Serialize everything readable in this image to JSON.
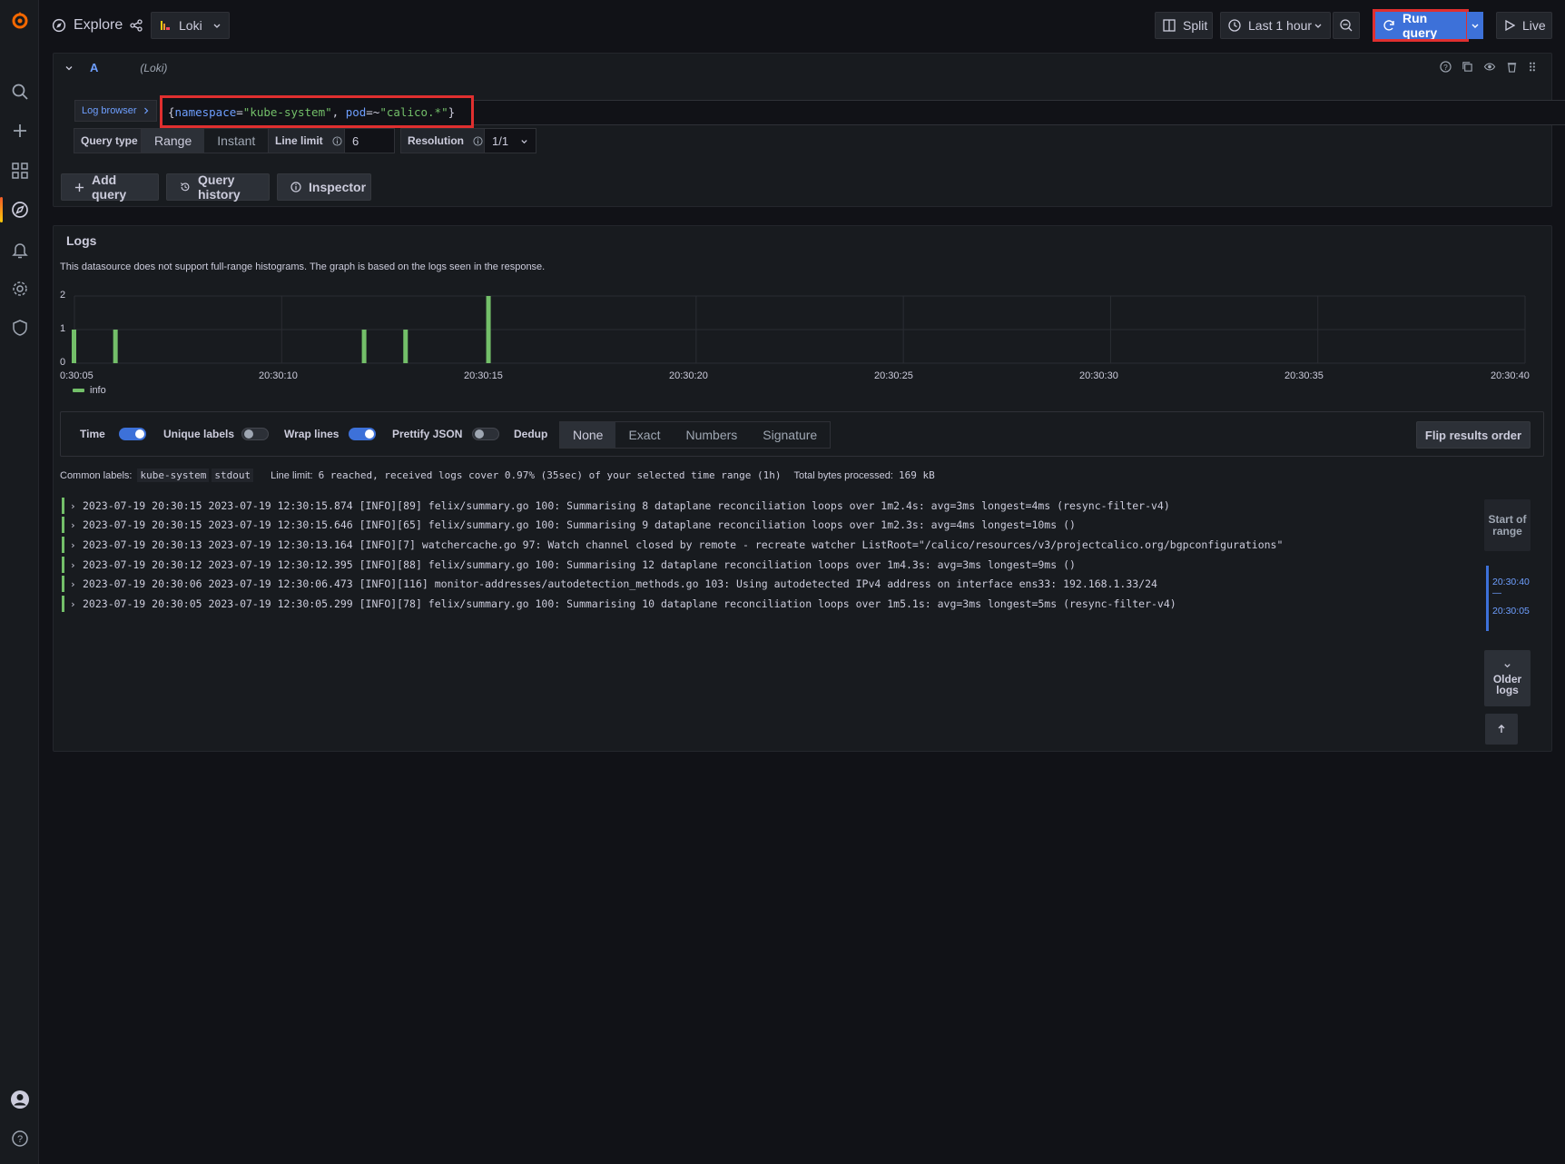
{
  "sidebar": {
    "items": [
      "search-icon",
      "plus-icon",
      "dashboards-icon",
      "explore-icon",
      "alerting-icon",
      "configuration-icon",
      "server-admin-icon",
      "profile-icon",
      "help-icon"
    ]
  },
  "topbar": {
    "title": "Explore",
    "datasource": "Loki",
    "split_label": "Split",
    "time_range": "Last 1 hour",
    "run_query_label": "Run query",
    "live_label": "Live"
  },
  "query": {
    "ref_id": "A",
    "datasource_hint": "(Loki)",
    "log_browser_label": "Log browser",
    "expr_parts": [
      "{",
      "namespace",
      "=",
      "\"kube-system\"",
      ", ",
      "pod",
      "=~",
      "\"calico.*\"",
      "}"
    ],
    "query_type_label": "Query type",
    "query_types": [
      "Range",
      "Instant"
    ],
    "selected_query_type": "Range",
    "line_limit_label": "Line limit",
    "line_limit_value": "6",
    "resolution_label": "Resolution",
    "resolution_value": "1/1",
    "add_query_label": "Add query",
    "query_history_label": "Query history",
    "inspector_label": "Inspector"
  },
  "logs": {
    "title": "Logs",
    "notice": "This datasource does not support full-range histograms. The graph is based on the logs seen in the response.",
    "legend": "info",
    "legend_color": "#73bf69",
    "options": {
      "time": "Time",
      "unique_labels": "Unique labels",
      "wrap_lines": "Wrap lines",
      "prettify_json": "Prettify JSON",
      "dedup": "Dedup",
      "time_on": true,
      "unique_labels_on": false,
      "wrap_lines_on": true,
      "prettify_json_on": false
    },
    "dedup_options": [
      "None",
      "Exact",
      "Numbers",
      "Signature"
    ],
    "dedup_selected": "None",
    "flip_label": "Flip results order",
    "meta": {
      "common_labels_label": "Common labels:",
      "common_labels": [
        "kube-system",
        "stdout"
      ],
      "line_limit_label": "Line limit:",
      "line_limit_text": "6 reached, received logs cover 0.97% (35sec) of your selected time range (1h)",
      "bytes_label": "Total bytes processed:",
      "bytes_value": "169 kB"
    },
    "rows": [
      "2023-07-19 20:30:15 2023-07-19 12:30:15.874 [INFO][89] felix/summary.go 100: Summarising 8 dataplane reconciliation loops over 1m2.4s: avg=3ms longest=4ms (resync-filter-v4)",
      "2023-07-19 20:30:15 2023-07-19 12:30:15.646 [INFO][65] felix/summary.go 100: Summarising 9 dataplane reconciliation loops over 1m2.3s: avg=4ms longest=10ms ()",
      "2023-07-19 20:30:13 2023-07-19 12:30:13.164 [INFO][7] watchercache.go 97: Watch channel closed by remote - recreate watcher ListRoot=\"/calico/resources/v3/projectcalico.org/bgpconfigurations\"",
      "2023-07-19 20:30:12 2023-07-19 12:30:12.395 [INFO][88] felix/summary.go 100: Summarising 12 dataplane reconciliation loops over 1m4.3s: avg=3ms longest=9ms ()",
      "2023-07-19 20:30:06 2023-07-19 12:30:06.473 [INFO][116] monitor-addresses/autodetection_methods.go 103: Using autodetected IPv4 address on interface ens33: 192.168.1.33/24",
      "2023-07-19 20:30:05 2023-07-19 12:30:05.299 [INFO][78] felix/summary.go 100: Summarising 10 dataplane reconciliation loops over 1m5.1s: avg=3ms longest=5ms (resync-filter-v4)"
    ],
    "nav": {
      "start_of_range": "Start of range",
      "range_to": "20:30:40",
      "range_sep": "—",
      "range_from": "20:30:05",
      "older_logs": "Older logs"
    }
  },
  "chart_data": {
    "type": "bar",
    "x_tick_labels": [
      "0:30:05",
      "20:30:10",
      "20:30:15",
      "20:30:20",
      "20:30:25",
      "20:30:30",
      "20:30:35",
      "20:30:40"
    ],
    "y_tick_labels": [
      "0",
      "1",
      "2"
    ],
    "ylim": [
      0,
      2
    ],
    "xlim_seconds": [
      5,
      40
    ],
    "series": [
      {
        "name": "info",
        "color": "#73bf69",
        "points": [
          {
            "x": "20:30:05",
            "y": 1
          },
          {
            "x": "20:30:06",
            "y": 1
          },
          {
            "x": "20:30:12",
            "y": 1
          },
          {
            "x": "20:30:13",
            "y": 1
          },
          {
            "x": "20:30:15",
            "y": 2
          }
        ]
      }
    ],
    "grid": true,
    "legend": "bottom-left"
  }
}
